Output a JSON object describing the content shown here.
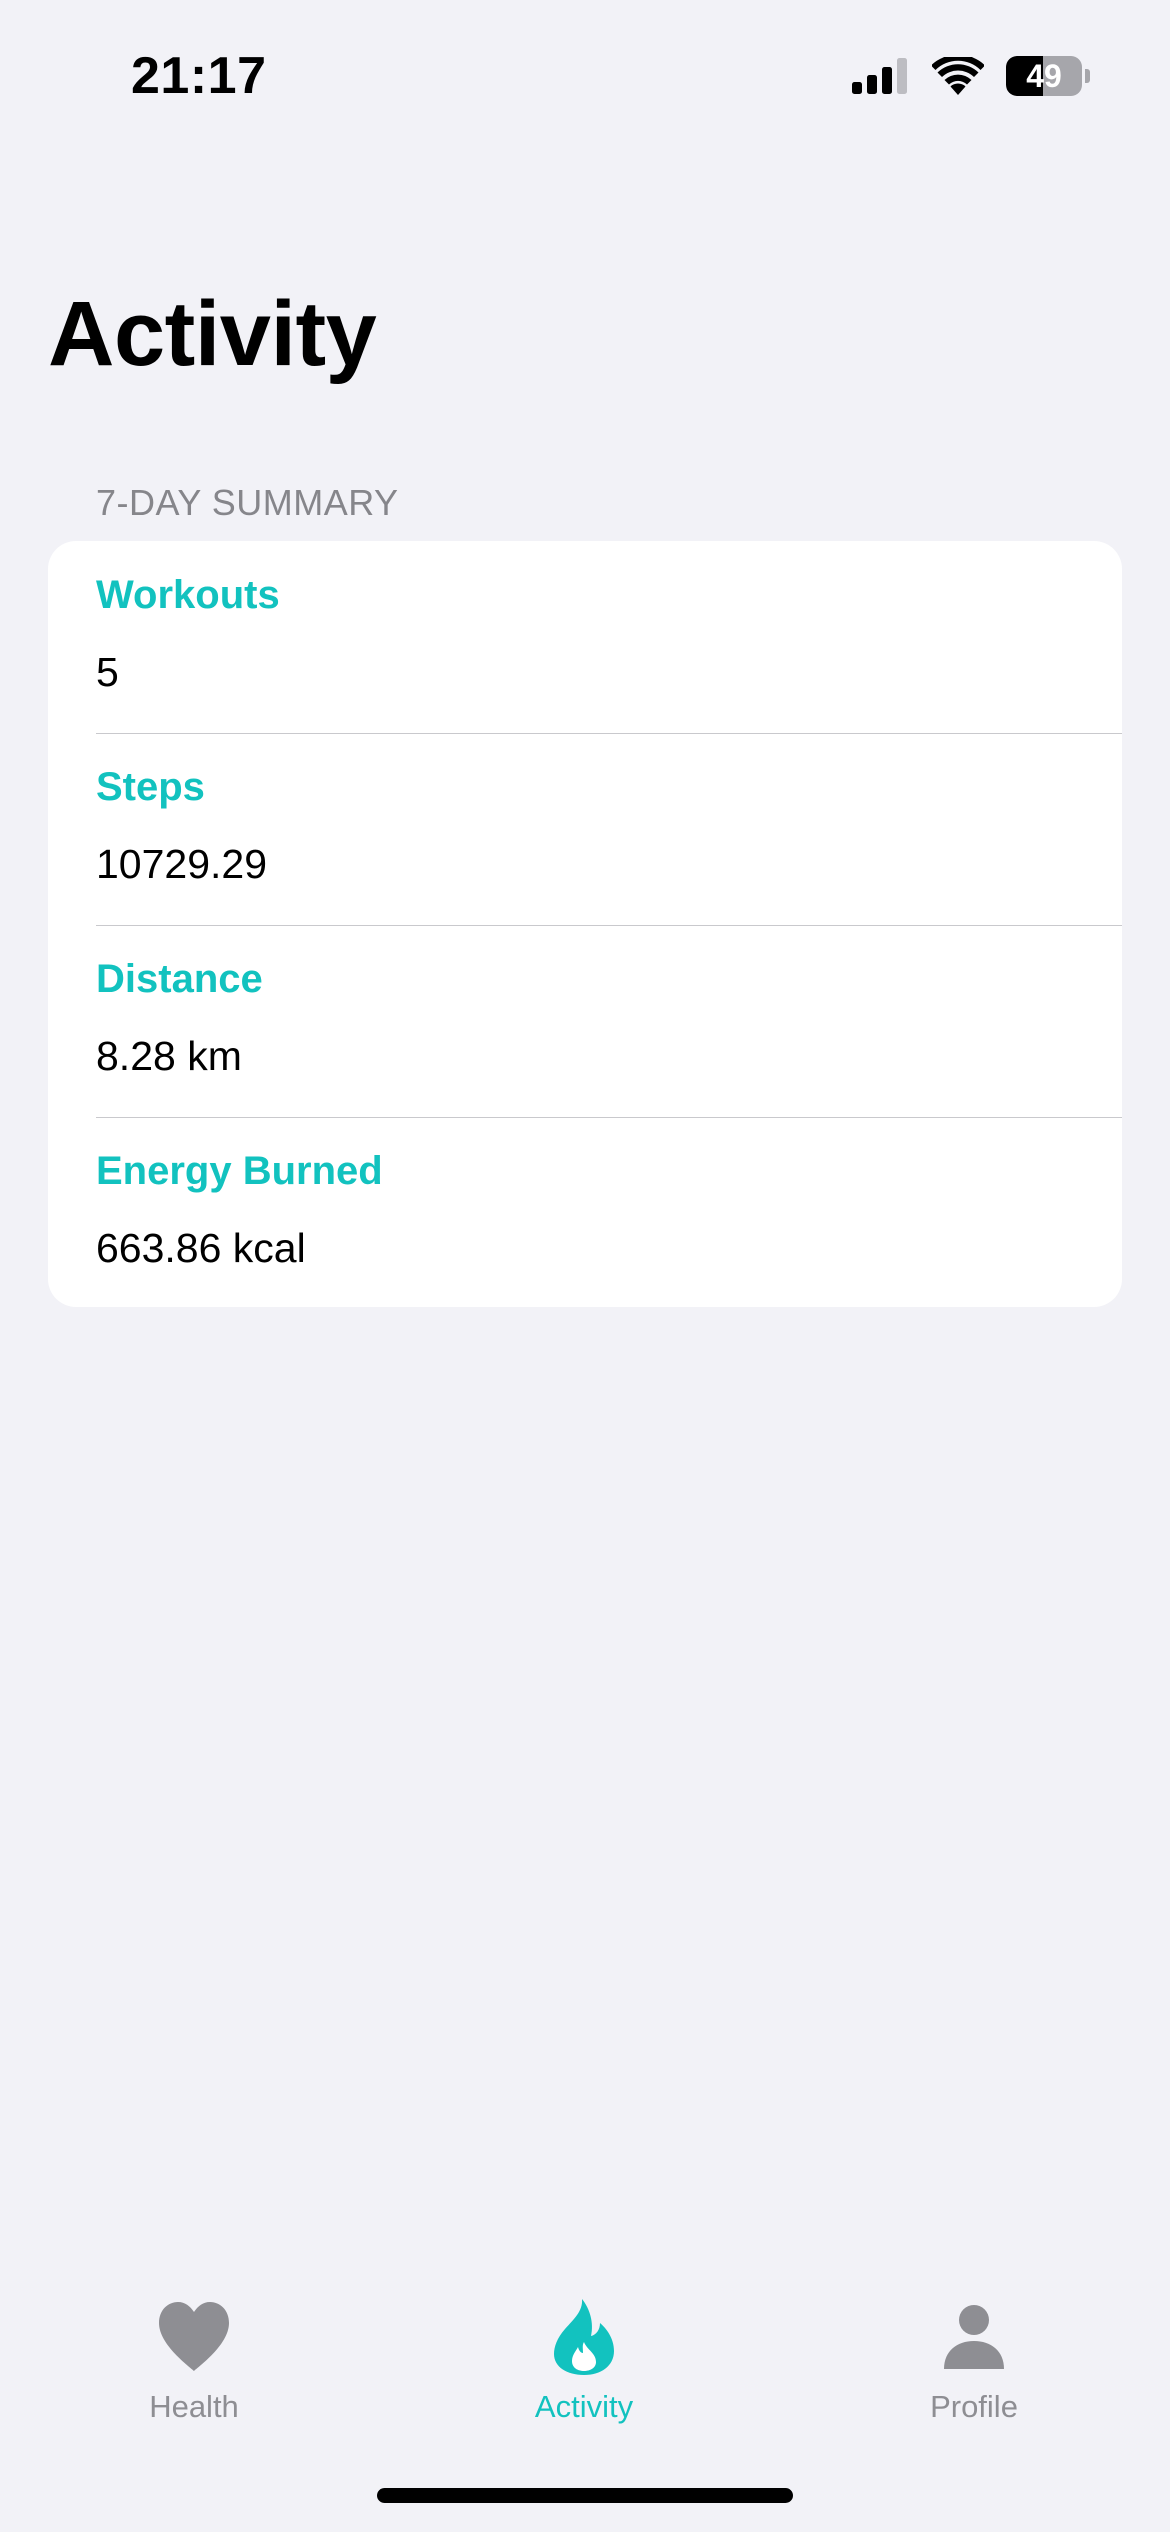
{
  "status_bar": {
    "time": "21:17",
    "battery_level": "49",
    "battery_fraction": 0.49,
    "icons": [
      "cellular-signal-icon",
      "wifi-icon",
      "battery-icon"
    ]
  },
  "page": {
    "title": "Activity"
  },
  "summary": {
    "section_header": "7-DAY SUMMARY",
    "rows": [
      {
        "label": "Workouts",
        "value": "5"
      },
      {
        "label": "Steps",
        "value": "10729.29"
      },
      {
        "label": "Distance",
        "value": "8.28 km"
      },
      {
        "label": "Energy Burned",
        "value": "663.86 kcal"
      }
    ]
  },
  "tab_bar": {
    "tabs": [
      {
        "label": "Health",
        "icon": "heart-icon",
        "selected": false
      },
      {
        "label": "Activity",
        "icon": "flame-icon",
        "selected": true
      },
      {
        "label": "Profile",
        "icon": "person-icon",
        "selected": false
      }
    ]
  },
  "colors": {
    "accent": "#12C2BF",
    "background": "#F2F2F7",
    "card": "#FFFFFF",
    "tab_inactive": "#8E8E93",
    "secondary_text": "#86868B"
  }
}
